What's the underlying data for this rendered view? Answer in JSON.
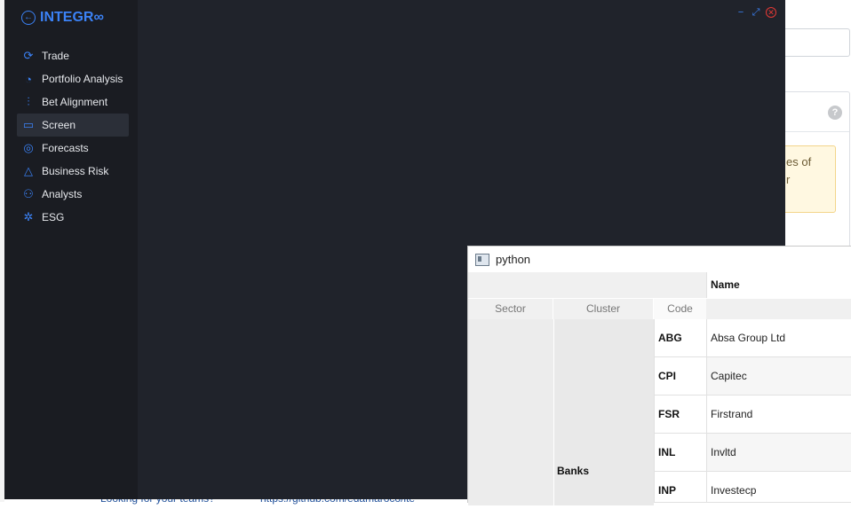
{
  "app": {
    "brand": "INTEGR∞",
    "nav": [
      {
        "label": "Trade",
        "icon": "refresh-icon"
      },
      {
        "label": "Portfolio Analysis",
        "icon": "pie-chart-icon"
      },
      {
        "label": "Bet Alignment",
        "icon": "sliders-icon"
      },
      {
        "label": "Screen",
        "icon": "monitor-icon",
        "active": true
      },
      {
        "label": "Forecasts",
        "icon": "target-icon"
      },
      {
        "label": "Business Risk",
        "icon": "warning-icon"
      },
      {
        "label": "Analysts",
        "icon": "users-icon"
      },
      {
        "label": "ESG",
        "icon": "esg-icon"
      }
    ]
  },
  "background_page": {
    "warning_lines": [
      "es of",
      "r"
    ],
    "bottom_link_left": "Looking for your teams?",
    "bottom_link_right": "https://github.com/edamaroco/ite"
  },
  "python_window": {
    "title": "python",
    "headers": {
      "name": "Name",
      "sector": "Sector",
      "cluster": "Cluster",
      "code": "Code"
    },
    "cluster_label": "Banks",
    "rows": [
      {
        "code": "ABG",
        "name": "Absa Group Ltd"
      },
      {
        "code": "CPI",
        "name": "Capitec"
      },
      {
        "code": "FSR",
        "name": "Firstrand"
      },
      {
        "code": "INL",
        "name": "Invltd"
      },
      {
        "code": "INP",
        "name": "Investecp"
      }
    ]
  }
}
